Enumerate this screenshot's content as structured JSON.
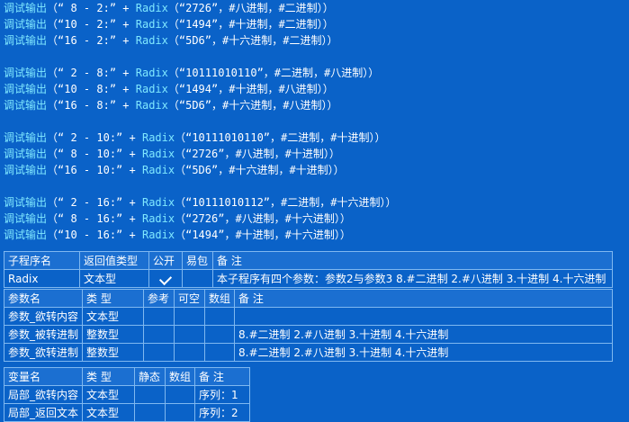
{
  "code_lines": [
    {
      "fn": "调试输出",
      "lparen": "（",
      "a": "“ 8 - 2:”",
      "plus": " + ",
      "cmd": "Radix",
      "b": "（“2726”，#八进制，#二进制）",
      "end": "）"
    },
    {
      "fn": "调试输出",
      "lparen": "（",
      "a": "“10 - 2:”",
      "plus": " + ",
      "cmd": "Radix",
      "b": "（“1494”，#十进制，#二进制）",
      "end": "）"
    },
    {
      "fn": "调试输出",
      "lparen": "（",
      "a": "“16 - 2:”",
      "plus": " + ",
      "cmd": "Radix",
      "b": "（“5D6”，#十六进制，#二进制）",
      "end": "）"
    },
    null,
    {
      "fn": "调试输出",
      "lparen": "（",
      "a": "“ 2 - 8:”",
      "plus": " + ",
      "cmd": "Radix",
      "b": "（“10111010110”，#二进制，#八进制）",
      "end": "）"
    },
    {
      "fn": "调试输出",
      "lparen": "（",
      "a": "“10 - 8:”",
      "plus": " + ",
      "cmd": "Radix",
      "b": "（“1494”，#十进制，#八进制）",
      "end": "）"
    },
    {
      "fn": "调试输出",
      "lparen": "（",
      "a": "“16 - 8:”",
      "plus": " + ",
      "cmd": "Radix",
      "b": "（“5D6”，#十六进制，#八进制）",
      "end": "）"
    },
    null,
    {
      "fn": "调试输出",
      "lparen": "（",
      "a": "“ 2 - 10:”",
      "plus": " + ",
      "cmd": "Radix",
      "b": "（“10111010110”，#二进制，#十进制）",
      "end": "）"
    },
    {
      "fn": "调试输出",
      "lparen": "（",
      "a": "“ 8 - 10:”",
      "plus": " + ",
      "cmd": "Radix",
      "b": "（“2726”，#八进制，#十进制）",
      "end": "）"
    },
    {
      "fn": "调试输出",
      "lparen": "（",
      "a": "“16 - 10:”",
      "plus": " + ",
      "cmd": "Radix",
      "b": "（“5D6”，#十六进制，#十进制）",
      "end": "）"
    },
    null,
    {
      "fn": "调试输出",
      "lparen": "（",
      "a": "“ 2 - 16:”",
      "plus": " + ",
      "cmd": "Radix",
      "b": "（“10111010112”，#二进制，#十六进制）",
      "end": "）"
    },
    {
      "fn": "调试输出",
      "lparen": "（",
      "a": "“ 8 - 16:”",
      "plus": " + ",
      "cmd": "Radix",
      "b": "（“2726”，#八进制，#十六进制）",
      "end": "）"
    },
    {
      "fn": "调试输出",
      "lparen": "（",
      "a": "“10 - 16:”",
      "plus": " + ",
      "cmd": "Radix",
      "b": "（“1494”，#十进制，#十六进制）",
      "end": "）"
    }
  ],
  "sub_table": {
    "headers": [
      "子程序名",
      "返回值类型",
      "公开",
      "易包",
      "备 注"
    ],
    "row": {
      "name": "Radix",
      "type": "文本型",
      "public_checked": true,
      "easy": "",
      "note": "本子程序有四个参数：参数2与参数3 8.#二进制 2.#八进制 3.十进制 4.十六进制"
    }
  },
  "param_table": {
    "headers": [
      "参数名",
      "类 型",
      "参考",
      "可空",
      "数组",
      "备 注"
    ],
    "rows": [
      {
        "name": "参数_欲转内容",
        "type": "文本型",
        "ref": "",
        "nullable": "",
        "array": "",
        "note": ""
      },
      {
        "name": "参数_被转进制",
        "type": "整数型",
        "ref": "",
        "nullable": "",
        "array": "",
        "note": "8.#二进制 2.#八进制 3.十进制 4.十六进制"
      },
      {
        "name": "参数_欲转进制",
        "type": "整数型",
        "ref": "",
        "nullable": "",
        "array": "",
        "note": "8.#二进制 2.#八进制 3.十进制 4.十六进制"
      }
    ]
  },
  "var_table": {
    "headers": [
      "变量名",
      "类 型",
      "静态",
      "数组",
      "备 注"
    ],
    "rows": [
      {
        "name": "局部_欲转内容",
        "type": "文本型",
        "static": "",
        "array": "",
        "note": "序列：1"
      },
      {
        "name": "局部_返回文本",
        "type": "文本型",
        "static": "",
        "array": "",
        "note": "序列：2"
      }
    ]
  }
}
